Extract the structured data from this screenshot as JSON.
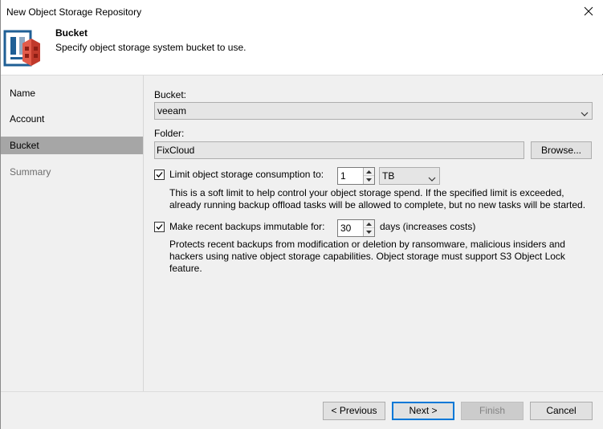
{
  "window": {
    "title": "New Object Storage Repository",
    "close_icon": "close-icon"
  },
  "header": {
    "title": "Bucket",
    "subtitle": "Specify object storage system bucket to use.",
    "icon": "object-storage-repository-icon"
  },
  "sidebar": {
    "items": [
      {
        "label": "Name",
        "state": "normal"
      },
      {
        "label": "Account",
        "state": "normal"
      },
      {
        "label": "Bucket",
        "state": "active"
      },
      {
        "label": "Summary",
        "state": "disabled"
      }
    ]
  },
  "form": {
    "bucket_label": "Bucket:",
    "bucket_value": "veeam",
    "folder_label": "Folder:",
    "folder_value": "FixCloud",
    "browse_label": "Browse...",
    "limit": {
      "checked": true,
      "label": "Limit object storage consumption to:",
      "value": "1",
      "unit": "TB",
      "description_line1": "This is a soft limit to help control your object storage spend. If the specified limit is exceeded,",
      "description_line2": "already running backup offload tasks will be allowed to complete, but no new tasks will be started."
    },
    "immutable": {
      "checked": true,
      "label": "Make recent backups immutable for:",
      "value": "30",
      "suffix": "days (increases costs)",
      "description_line1": "Protects recent backups from modification or deletion by ransomware, malicious insiders and",
      "description_line2": "hackers using native object storage capabilities. Object storage must support S3 Object Lock",
      "description_line3": "feature."
    }
  },
  "footer": {
    "previous_label": "< Previous",
    "next_label": "Next >",
    "finish_label": "Finish",
    "cancel_label": "Cancel"
  },
  "colors": {
    "active_nav": "#a6a6a6",
    "panel_bg": "#f0f0f0",
    "default_button_border": "#0078d7",
    "icon_red": "#c0392b",
    "icon_blue": "#1f5f95"
  }
}
